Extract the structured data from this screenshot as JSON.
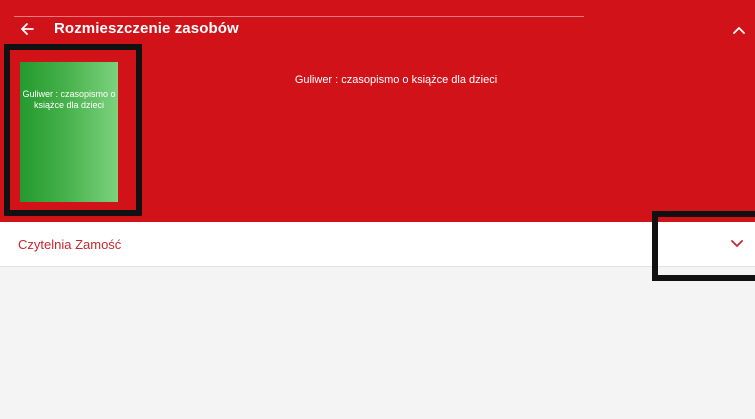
{
  "header": {
    "title": "Rozmieszczenie zasobów",
    "back_icon": "arrow-left-icon",
    "collapse_icon": "chevron-up-icon",
    "background_color": "#d21219"
  },
  "book": {
    "cover_text": "Guliwer : czasopismo o książce dla dzieci",
    "title": "Guliwer : czasopismo o książce dla dzieci"
  },
  "locations": {
    "items": [
      {
        "label": "Czytelnia Zamość",
        "expand_icon": "chevron-down-icon"
      }
    ]
  }
}
